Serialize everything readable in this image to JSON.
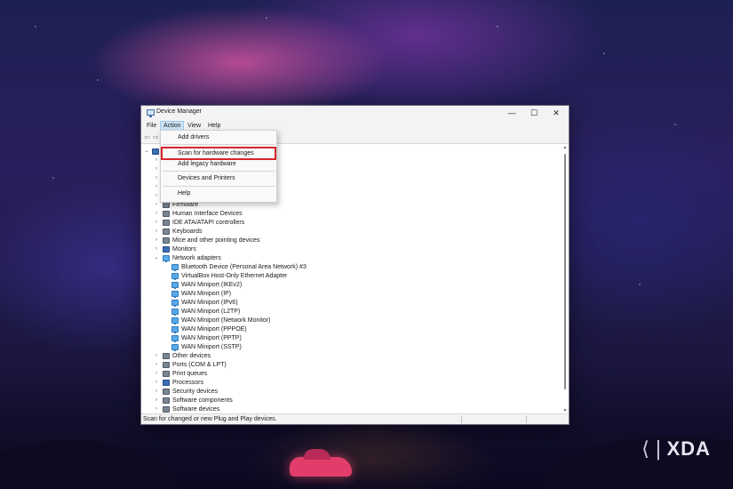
{
  "window": {
    "title": "Device Manager",
    "controls": {
      "minimize": "—",
      "maximize": "☐",
      "close": "✕"
    }
  },
  "menubar": {
    "items": [
      "File",
      "Action",
      "View",
      "Help"
    ]
  },
  "toolbar": {
    "back": "⇦",
    "forward": "⇨"
  },
  "action_menu": {
    "items": [
      {
        "label": "Add drivers"
      },
      {
        "label": "Scan for hardware changes",
        "highlighted": true
      },
      {
        "label": "Add legacy hardware"
      },
      {
        "label": "Devices and Printers"
      },
      {
        "label": "Help"
      }
    ]
  },
  "tree": {
    "categories": [
      {
        "label": "Firmware",
        "expanded": false
      },
      {
        "label": "Human Interface Devices",
        "expanded": false
      },
      {
        "label": "IDE ATA/ATAPI controllers",
        "expanded": false
      },
      {
        "label": "Keyboards",
        "expanded": false
      },
      {
        "label": "Mice and other pointing devices",
        "expanded": false
      },
      {
        "label": "Monitors",
        "expanded": false
      },
      {
        "label": "Network adapters",
        "expanded": true
      }
    ],
    "network_adapters": [
      "Bluetooth Device (Personal Area Network) #3",
      "VirtualBox Host-Only Ethernet Adapter",
      "WAN Miniport (IKEv2)",
      "WAN Miniport (IP)",
      "WAN Miniport (IPv6)",
      "WAN Miniport (L2TP)",
      "WAN Miniport (Network Monitor)",
      "WAN Miniport (PPPOE)",
      "WAN Miniport (PPTP)",
      "WAN Miniport (SSTP)"
    ],
    "categories_after": [
      "Other devices",
      "Ports (COM & LPT)",
      "Print queues",
      "Processors",
      "Security devices",
      "Software components",
      "Software devices"
    ]
  },
  "statusbar": {
    "text": "Scan for changed or new Plug and Play devices."
  },
  "watermark": {
    "mark": "⟨|",
    "text": "XDA"
  },
  "colors": {
    "highlight_border": "#d8262e",
    "menu_active_bg": "#cce4f7",
    "adapter_icon": "#5aa9e6"
  }
}
